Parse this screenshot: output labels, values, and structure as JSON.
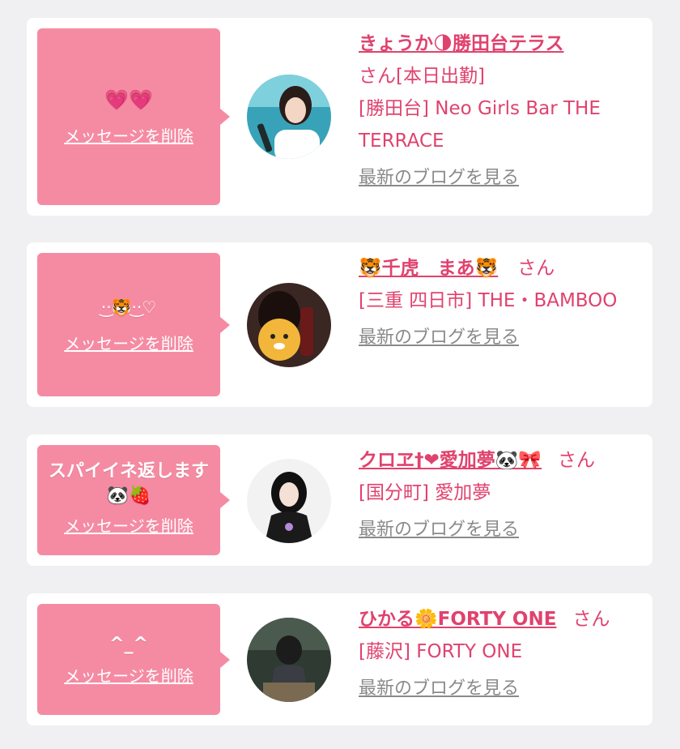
{
  "cards": [
    {
      "message": "💗💗",
      "delete_label": "メッセージを削除",
      "name": "きょうか🌗勝田台テラス",
      "san_suffix": "さん[本日出勤]",
      "shop": "[勝田台] Neo Girls Bar THE TERRACE",
      "blog_link": "最新のブログを見る"
    },
    {
      "message": "·͜·🐯·͜·♡",
      "delete_label": "メッセージを削除",
      "name": "🐯千虎　まあ🐯",
      "san_suffix": "さん",
      "shop": "[三重 四日市] THE・BAMBOO",
      "blog_link": "最新のブログを見る"
    },
    {
      "message": "スパイイネ返します🐼🍓",
      "delete_label": "メッセージを削除",
      "name": "クロヱ†❤愛加夢🐼🎀",
      "san_suffix": "さん",
      "shop": "[国分町] 愛加夢",
      "blog_link": "最新のブログを見る"
    },
    {
      "message": "^_^",
      "delete_label": "メッセージを削除",
      "name": "ひかる🌼FORTY ONE",
      "san_suffix": "さん",
      "shop": "[藤沢] FORTY ONE",
      "blog_link": "最新のブログを見る"
    }
  ],
  "colors": {
    "bubble": "#f58ba3",
    "name": "#e0426e",
    "blog": "#8a8a8a",
    "background": "#f0f0f2"
  }
}
